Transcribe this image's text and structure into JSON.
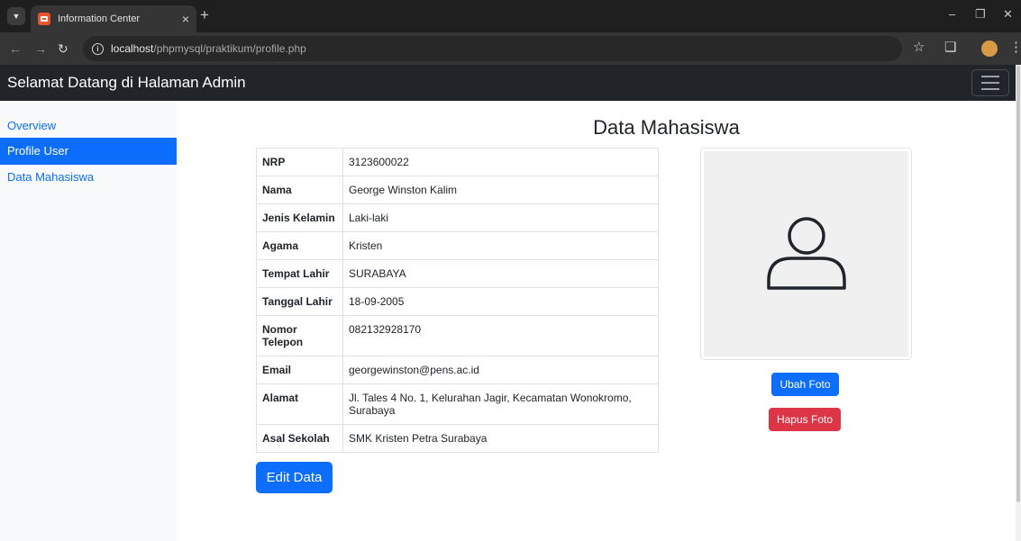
{
  "browser": {
    "tab_title": "Information Center",
    "url_host": "localhost",
    "url_path": "/phpmysql/praktikum/profile.php"
  },
  "navbar": {
    "brand": "Selamat Datang di Halaman Admin"
  },
  "sidebar": {
    "items": [
      {
        "label": "Overview",
        "active": false
      },
      {
        "label": "Profile User",
        "active": true
      },
      {
        "label": "Data Mahasiswa",
        "active": false
      }
    ]
  },
  "main": {
    "title": "Data Mahasiswa",
    "rows": [
      {
        "label": "NRP",
        "value": "3123600022"
      },
      {
        "label": "Nama",
        "value": "George Winston Kalim"
      },
      {
        "label": "Jenis Kelamin",
        "value": "Laki-laki"
      },
      {
        "label": "Agama",
        "value": "Kristen"
      },
      {
        "label": "Tempat Lahir",
        "value": "SURABAYA"
      },
      {
        "label": "Tanggal Lahir",
        "value": "18-09-2005"
      },
      {
        "label": "Nomor Telepon",
        "value": "082132928170"
      },
      {
        "label": "Email",
        "value": "georgewinston@pens.ac.id"
      },
      {
        "label": "Alamat",
        "value": "Jl. Tales 4 No. 1, Kelurahan Jagir, Kecamatan Wonokromo, Surabaya"
      },
      {
        "label": "Asal Sekolah",
        "value": "SMK Kristen Petra Surabaya"
      }
    ],
    "ubah_foto_label": "Ubah Foto",
    "hapus_foto_label": "Hapus Foto",
    "edit_label": "Edit Data",
    "photo_icon": "user-icon"
  },
  "colors": {
    "primary": "#0d6efd",
    "danger": "#dc3545",
    "navbar": "#212529",
    "sidebar": "#f8f9fa"
  }
}
